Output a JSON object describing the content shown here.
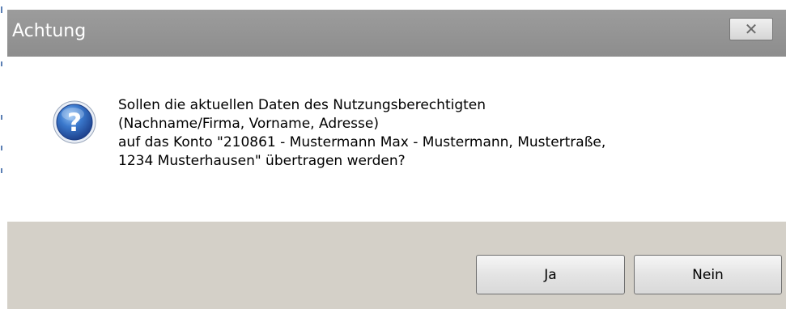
{
  "dialog": {
    "title": "Achtung",
    "close_glyph": "✕",
    "message_lines": [
      "Sollen die aktuellen Daten des Nutzungsberechtigten",
      "(Nachname/Firma, Vorname, Adresse)",
      "auf das Konto \"210861 - Mustermann Max - Mustermann, Mustertraße,",
      "1234 Musterhausen\" übertragen werden?"
    ],
    "icon": "question-icon",
    "buttons": {
      "yes_label": "Ja",
      "no_label": "Nein"
    }
  },
  "colors": {
    "titlebar": "#8d8d8d",
    "footer": "#d4d0c8",
    "icon_blue": "#2f66b8"
  }
}
